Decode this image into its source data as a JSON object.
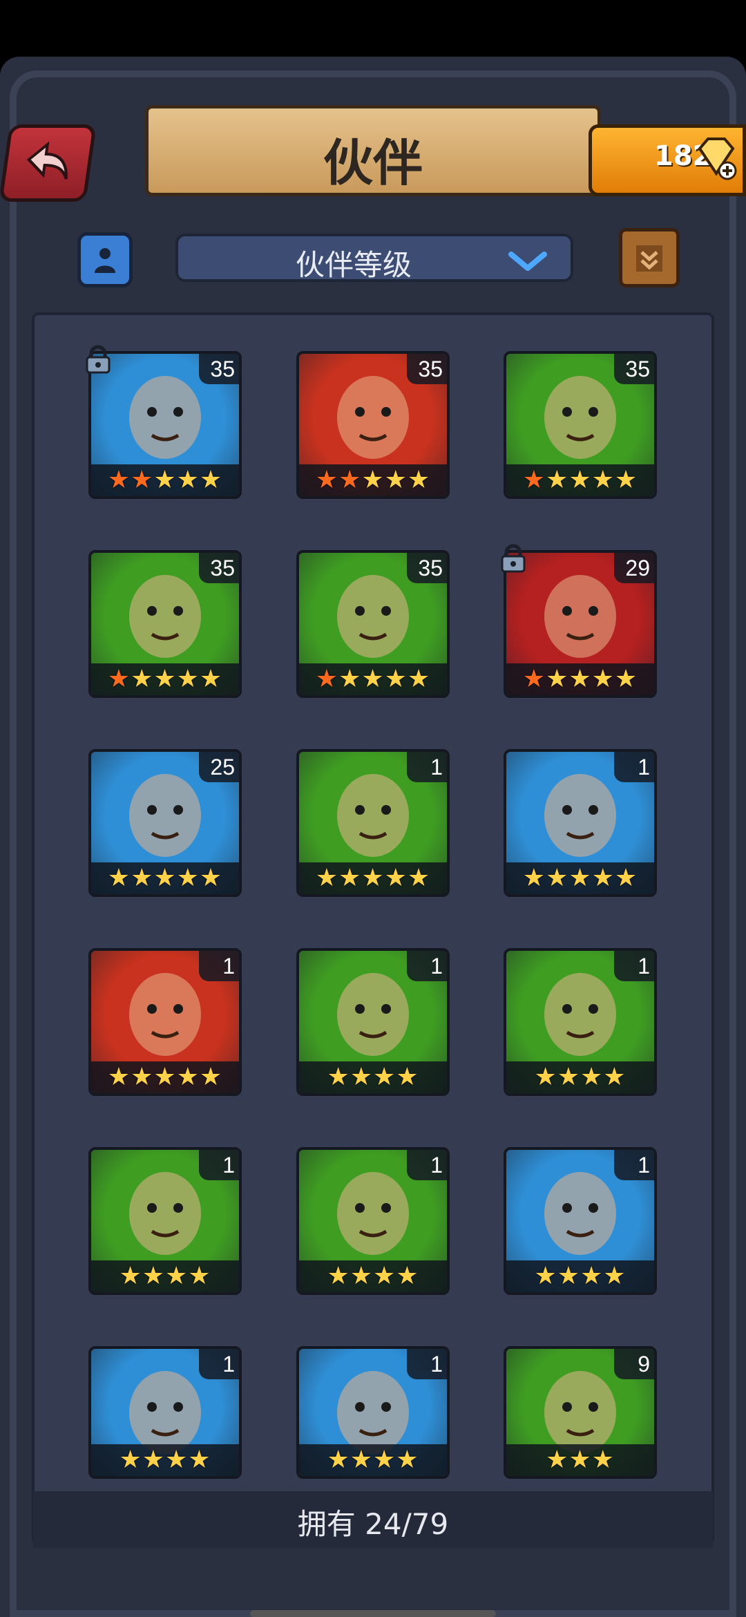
{
  "header": {
    "title": "伙伴",
    "gems": "182"
  },
  "toolbar": {
    "sort_label": "伙伴等级"
  },
  "footer": {
    "owned_label": "拥有 24/79"
  },
  "colors": {
    "frame": "#2b3040",
    "accent_gold": "#ffb431",
    "back_red": "#c3333b",
    "star_gold": "#ffd24a",
    "star_orange": "#ff6a1f"
  },
  "companions": [
    {
      "level": "35",
      "stars_total": 5,
      "stars_orange": 2,
      "bg": "#2f8fd6",
      "locked": true
    },
    {
      "level": "35",
      "stars_total": 5,
      "stars_orange": 2,
      "bg": "#c9321e",
      "locked": false
    },
    {
      "level": "35",
      "stars_total": 5,
      "stars_orange": 1,
      "bg": "#3f9e22",
      "locked": false
    },
    {
      "level": "35",
      "stars_total": 5,
      "stars_orange": 1,
      "bg": "#3f9e22",
      "locked": false
    },
    {
      "level": "35",
      "stars_total": 5,
      "stars_orange": 1,
      "bg": "#3f9e22",
      "locked": false
    },
    {
      "level": "29",
      "stars_total": 5,
      "stars_orange": 1,
      "bg": "#b52020",
      "locked": true
    },
    {
      "level": "25",
      "stars_total": 5,
      "stars_orange": 0,
      "bg": "#2f8fd6",
      "locked": false
    },
    {
      "level": "1",
      "stars_total": 5,
      "stars_orange": 0,
      "bg": "#3f9e22",
      "locked": false
    },
    {
      "level": "1",
      "stars_total": 5,
      "stars_orange": 0,
      "bg": "#2f8fd6",
      "locked": false
    },
    {
      "level": "1",
      "stars_total": 5,
      "stars_orange": 0,
      "bg": "#c9321e",
      "locked": false
    },
    {
      "level": "1",
      "stars_total": 4,
      "stars_orange": 0,
      "bg": "#3f9e22",
      "locked": false
    },
    {
      "level": "1",
      "stars_total": 4,
      "stars_orange": 0,
      "bg": "#3f9e22",
      "locked": false
    },
    {
      "level": "1",
      "stars_total": 4,
      "stars_orange": 0,
      "bg": "#3f9e22",
      "locked": false
    },
    {
      "level": "1",
      "stars_total": 4,
      "stars_orange": 0,
      "bg": "#3f9e22",
      "locked": false
    },
    {
      "level": "1",
      "stars_total": 4,
      "stars_orange": 0,
      "bg": "#2f8fd6",
      "locked": false
    },
    {
      "level": "1",
      "stars_total": 4,
      "stars_orange": 0,
      "bg": "#2f8fd6",
      "locked": false
    },
    {
      "level": "1",
      "stars_total": 4,
      "stars_orange": 0,
      "bg": "#2f8fd6",
      "locked": false
    },
    {
      "level": "9",
      "stars_total": 3,
      "stars_orange": 0,
      "bg": "#3f9e22",
      "locked": false
    }
  ]
}
